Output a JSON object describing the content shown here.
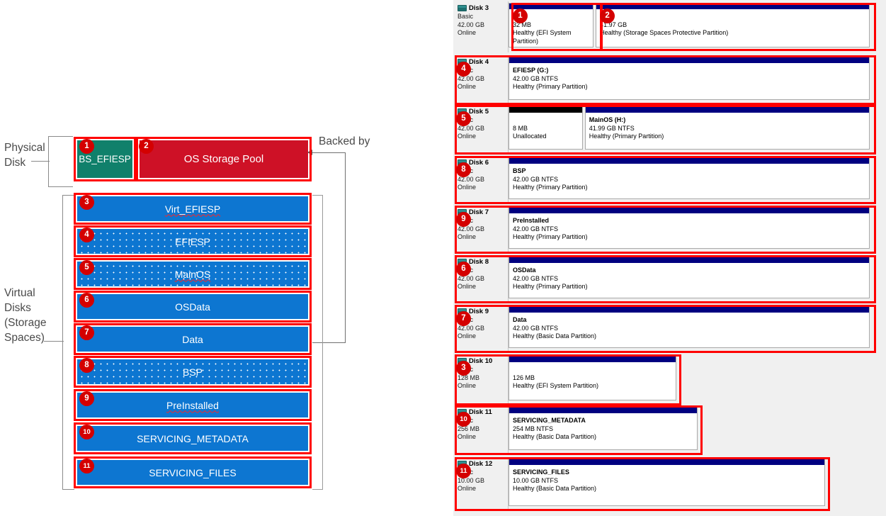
{
  "diagram": {
    "labels": {
      "physical_disk": "Physical\nDisk",
      "virtual_disks": "Virtual\nDisks\n(Storage\nSpaces)",
      "backed_by": "Backed by"
    },
    "physical": [
      {
        "badge": "1",
        "name": "BS_EFIESP",
        "color": "#10806b"
      },
      {
        "badge": "2",
        "name": "OS Storage Pool",
        "color": "#ce1126"
      }
    ],
    "virtual": [
      {
        "badge": "3",
        "name": "Virt_EFIESP",
        "dotted": false,
        "squiggle": true
      },
      {
        "badge": "4",
        "name": "EFIESP",
        "dotted": true,
        "squiggle": false
      },
      {
        "badge": "5",
        "name": "MainOS",
        "dotted": true,
        "squiggle": true
      },
      {
        "badge": "6",
        "name": "OSData",
        "dotted": false,
        "squiggle": false
      },
      {
        "badge": "7",
        "name": "Data",
        "dotted": false,
        "squiggle": false
      },
      {
        "badge": "8",
        "name": "BSP",
        "dotted": true,
        "squiggle": false
      },
      {
        "badge": "9",
        "name": "PreInstalled",
        "dotted": false,
        "squiggle": true
      },
      {
        "badge": "10",
        "name": "SERVICING_METADATA",
        "dotted": false,
        "squiggle": false
      },
      {
        "badge": "11",
        "name": "SERVICING_FILES",
        "dotted": false,
        "squiggle": false
      }
    ]
  },
  "disk_management": {
    "disks": [
      {
        "name": "Disk 3",
        "type": "Basic",
        "size": "42.00 GB",
        "status": "Online",
        "partitions": [
          {
            "badge": "1",
            "name": "",
            "size": "32 MB",
            "health": "Healthy (EFI System Partition)",
            "unallocated": false
          },
          {
            "badge": "2",
            "name": "Pool",
            "size": "41.97 GB",
            "health": "Healthy (Storage Spaces Protective Partition)",
            "unallocated": false
          }
        ]
      },
      {
        "name": "Disk 4",
        "type": "Basic",
        "size": "42.00 GB",
        "status": "Online",
        "badge": "4",
        "partitions": [
          {
            "name": "EFIESP  (G:)",
            "size": "42.00 GB NTFS",
            "health": "Healthy (Primary Partition)",
            "unallocated": false
          }
        ]
      },
      {
        "name": "Disk 5",
        "type": "Basic",
        "size": "42.00 GB",
        "status": "Online",
        "badge": "5",
        "partitions": [
          {
            "name": "",
            "size": "8 MB",
            "health": "Unallocated",
            "unallocated": true
          },
          {
            "name": "MainOS  (H:)",
            "size": "41.99 GB NTFS",
            "health": "Healthy (Primary Partition)",
            "unallocated": false
          }
        ]
      },
      {
        "name": "Disk 6",
        "type": "Basic",
        "size": "42.00 GB",
        "status": "Online",
        "badge": "8",
        "partitions": [
          {
            "name": "BSP",
            "size": "42.00 GB NTFS",
            "health": "Healthy (Primary Partition)",
            "unallocated": false
          }
        ]
      },
      {
        "name": "Disk 7",
        "type": "Basic",
        "size": "42.00 GB",
        "status": "Online",
        "badge": "9",
        "partitions": [
          {
            "name": "PreInstalled",
            "size": "42.00 GB NTFS",
            "health": "Healthy (Primary Partition)",
            "unallocated": false
          }
        ]
      },
      {
        "name": "Disk 8",
        "type": "Basic",
        "size": "42.00 GB",
        "status": "Online",
        "badge": "6",
        "partitions": [
          {
            "name": "OSData",
            "size": "42.00 GB NTFS",
            "health": "Healthy (Primary Partition)",
            "unallocated": false
          }
        ]
      },
      {
        "name": "Disk 9",
        "type": "Basic",
        "size": "42.00 GB",
        "status": "Online",
        "badge": "7",
        "partitions": [
          {
            "name": "Data",
            "size": "42.00 GB NTFS",
            "health": "Healthy (Basic Data Partition)",
            "unallocated": false
          }
        ]
      },
      {
        "name": "Disk 10",
        "type": "Basic",
        "size": "128 MB",
        "status": "Online",
        "badge": "3",
        "partitions": [
          {
            "name": "",
            "size": "126 MB",
            "health": "Healthy (EFI System Partition)",
            "unallocated": false
          }
        ]
      },
      {
        "name": "Disk 11",
        "type": "Basic",
        "size": "256 MB",
        "status": "Online",
        "badge": "10",
        "partitions": [
          {
            "name": "SERVICING_METADATA",
            "size": "254 MB NTFS",
            "health": "Healthy (Basic Data Partition)",
            "unallocated": false
          }
        ]
      },
      {
        "name": "Disk 12",
        "type": "Basic",
        "size": "10.00 GB",
        "status": "Online",
        "badge": "11",
        "partitions": [
          {
            "name": "SERVICING_FILES",
            "size": "10.00 GB NTFS",
            "health": "Healthy (Basic Data Partition)",
            "unallocated": false
          }
        ]
      }
    ]
  },
  "colors": {
    "highlight": "#ff0000",
    "badge": "#d40000",
    "virtual_disk": "#0d76d1",
    "storage_pool": "#ce1126",
    "bs_efiesp": "#10806b",
    "partition_bar": "#000080"
  }
}
